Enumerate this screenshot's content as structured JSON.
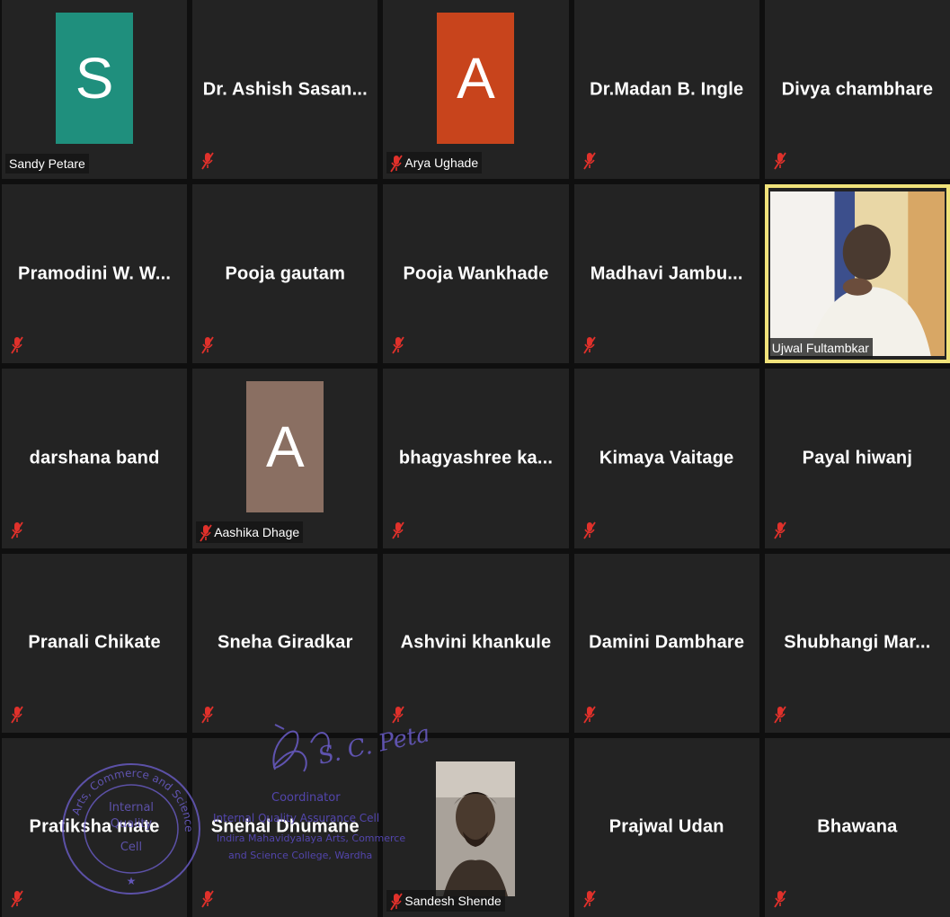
{
  "meeting": {
    "participants": [
      {
        "name": "Sandy Petare",
        "display": "avatar",
        "initial": "S",
        "avatar_color": "#1f8f7d",
        "muted": false,
        "active": false
      },
      {
        "name": "Dr. Ashish Sasan...",
        "display": "name",
        "muted": true,
        "active": false
      },
      {
        "name": "Arya Ughade",
        "display": "avatar",
        "initial": "A",
        "avatar_color": "#c8441c",
        "muted": true,
        "active": false
      },
      {
        "name": "Dr.Madan B. Ingle",
        "display": "name",
        "muted": true,
        "active": false
      },
      {
        "name": "Divya chambhare",
        "display": "name",
        "muted": true,
        "active": false
      },
      {
        "name": "Pramodini W. W...",
        "display": "name",
        "muted": true,
        "active": false
      },
      {
        "name": "Pooja gautam",
        "display": "name",
        "muted": true,
        "active": false
      },
      {
        "name": "Pooja Wankhade",
        "display": "name",
        "muted": true,
        "active": false
      },
      {
        "name": "Madhavi  Jambu...",
        "display": "name",
        "muted": true,
        "active": false
      },
      {
        "name": "Ujwal Fultambkar",
        "display": "video",
        "muted": false,
        "active": true
      },
      {
        "name": "darshana band",
        "display": "name",
        "muted": true,
        "active": false
      },
      {
        "name": "Aashika Dhage",
        "display": "avatar",
        "initial": "A",
        "avatar_color": "#8a6f62",
        "muted": true,
        "active": false
      },
      {
        "name": "bhagyashree  ka...",
        "display": "name",
        "muted": true,
        "active": false
      },
      {
        "name": "Kimaya Vaitage",
        "display": "name",
        "muted": true,
        "active": false
      },
      {
        "name": "Payal hiwanj",
        "display": "name",
        "muted": true,
        "active": false
      },
      {
        "name": "Pranali Chikate",
        "display": "name",
        "muted": true,
        "active": false
      },
      {
        "name": "Sneha Giradkar",
        "display": "name",
        "muted": true,
        "active": false
      },
      {
        "name": "Ashvini khankule",
        "display": "name",
        "muted": true,
        "active": false
      },
      {
        "name": "Damini Dambhare",
        "display": "name",
        "muted": true,
        "active": false
      },
      {
        "name": "Shubhangi  Mar...",
        "display": "name",
        "muted": true,
        "active": false
      },
      {
        "name": "Pratiksha mate",
        "display": "name",
        "muted": true,
        "active": false
      },
      {
        "name": "Snehal Dhumane",
        "display": "name",
        "muted": true,
        "active": false
      },
      {
        "name": "Sandesh Shende",
        "display": "photo",
        "muted": true,
        "active": false
      },
      {
        "name": "Prajwal Udan",
        "display": "name",
        "muted": true,
        "active": false
      },
      {
        "name": "Bhawana",
        "display": "name",
        "muted": true,
        "active": false
      }
    ]
  },
  "overlay": {
    "signature": "S. C. Petare",
    "coordinator_title": "Coordinator",
    "coordinator_line1": "Internal Quality Assurance Cell",
    "coordinator_line2": "Indira Mahavidyalaya Arts, Commerce",
    "coordinator_line3": "and Science College, Wardha",
    "seal_outer": "Arts, Commerce and Science College",
    "seal_inner_1": "Internal",
    "seal_inner_2": "Quality",
    "seal_inner_3": "Cell"
  },
  "colors": {
    "tile_bg": "#232323",
    "grid_bg": "#0f0f0f",
    "active_border": "#f0e27a",
    "muted_icon": "#e0312b",
    "stamp_ink": "#5b4bc4"
  }
}
